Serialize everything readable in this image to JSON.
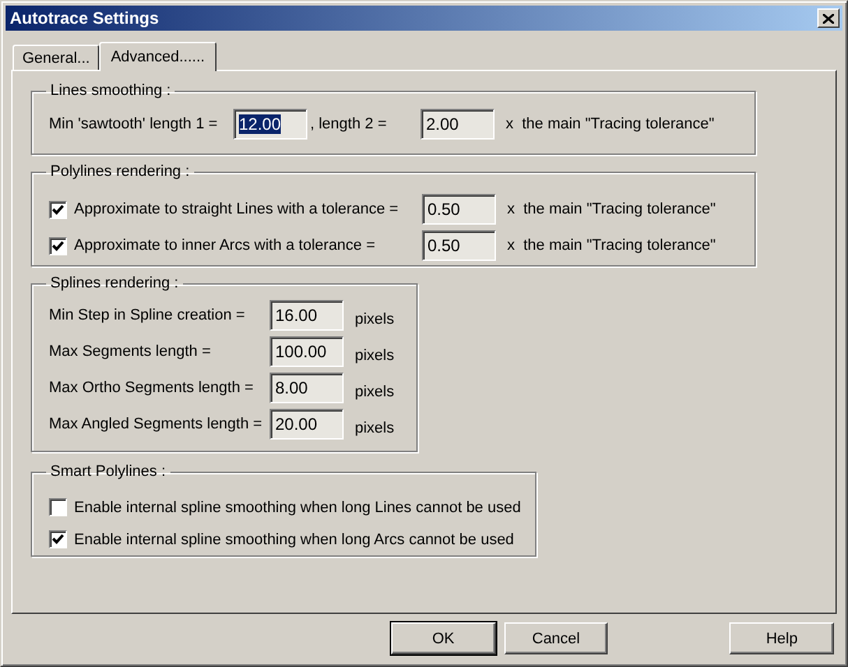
{
  "window": {
    "title": "Autotrace Settings"
  },
  "tabs": [
    {
      "label": "General...",
      "selected": false
    },
    {
      "label": "Advanced......",
      "selected": true
    }
  ],
  "lines_smoothing": {
    "title": "Lines smoothing :",
    "label_1": "Min 'sawtooth' length 1 =",
    "field_1": {
      "value": "12.00",
      "highlighted": true
    },
    "label_2": ", length 2 =",
    "field_2": {
      "value": "2.00",
      "highlighted": false
    },
    "suffix": "x  the main \"Tracing tolerance\""
  },
  "polylines": {
    "title": "Polylines rendering :",
    "rows": [
      {
        "checked": true,
        "label": "Approximate to straight Lines with a tolerance =",
        "value": "0.50",
        "suffix": "x  the main \"Tracing tolerance\""
      },
      {
        "checked": true,
        "label": "Approximate to inner Arcs with a tolerance =",
        "value": "0.50",
        "suffix": "x  the main \"Tracing tolerance\""
      }
    ]
  },
  "splines": {
    "title": "Splines rendering :",
    "rows": [
      {
        "label": "Min Step in Spline creation =",
        "value": "16.00",
        "unit": "pixels"
      },
      {
        "label": "Max Segments length =",
        "value": "100.00",
        "unit": "pixels"
      },
      {
        "label": "Max Ortho Segments length =",
        "value": "8.00",
        "unit": "pixels"
      },
      {
        "label": "Max Angled Segments length =",
        "value": "20.00",
        "unit": "pixels"
      }
    ]
  },
  "smart": {
    "title": "Smart Polylines :",
    "options": [
      {
        "checked": false,
        "label": "Enable internal spline smoothing when long Lines cannot be used"
      },
      {
        "checked": true,
        "label": "Enable internal spline smoothing when long Arcs cannot be used"
      }
    ]
  },
  "buttons": [
    {
      "label": "OK",
      "default": true
    },
    {
      "label": "Cancel",
      "default": false
    },
    {
      "label": "Help",
      "default": false
    }
  ]
}
